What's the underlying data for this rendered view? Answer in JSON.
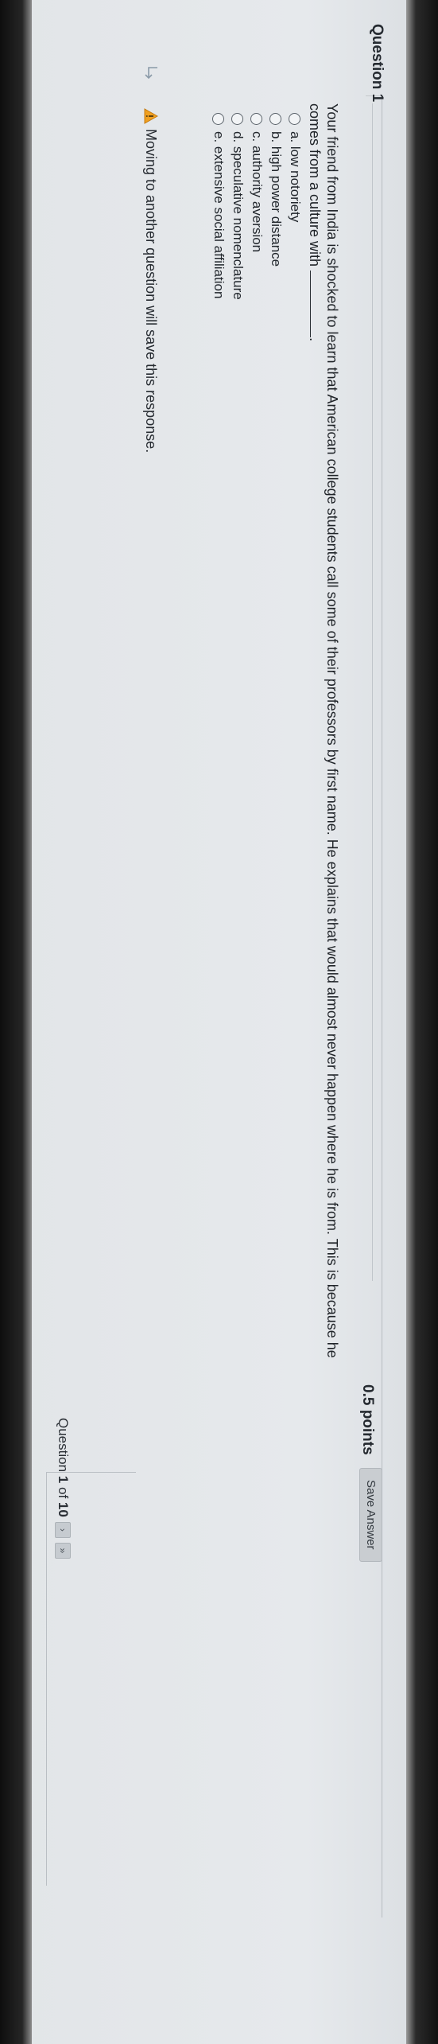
{
  "question": {
    "title": "Question 1",
    "points": "0.5 points",
    "save_label": "Save Answer",
    "text_before_blank": "Your friend from India is shocked to learn that American college students call some of their professors by first name. He explains that would almost never happen where he is from. This is because he comes from a culture with",
    "text_after_blank": "."
  },
  "options": [
    {
      "label": "a. low notoriety"
    },
    {
      "label": "b. high power distance"
    },
    {
      "label": "c. authority aversion"
    },
    {
      "label": "d. speculative nomenclature"
    },
    {
      "label": "e. extensive social affiliation"
    }
  ],
  "notice": {
    "text": "Moving to another question will save this response.",
    "icon": "warning-icon",
    "warning_color": "#f0a020"
  },
  "footer": {
    "prefix": "Question",
    "current": "1",
    "of_text": "of",
    "total": "10",
    "next_icon": "next-arrow-icon",
    "last_icon": "double-chevron-icon",
    "next_symbol": "›",
    "last_symbol": "»"
  }
}
